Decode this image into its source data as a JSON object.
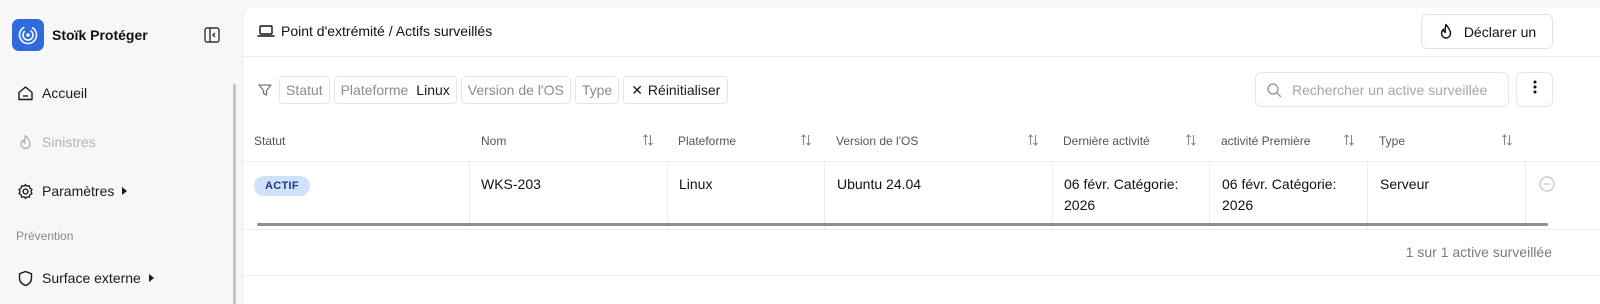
{
  "brand": {
    "name": "Stoïk Protéger",
    "accent": "#2f6bdc"
  },
  "sidebar": {
    "items": [
      {
        "label": "Accueil",
        "icon": "home-icon"
      },
      {
        "label": "Sinistres",
        "icon": "flame-icon",
        "disabled": true
      },
      {
        "label": "Paramètres",
        "icon": "gear-icon"
      }
    ],
    "section_label": "Prévention",
    "section_items": [
      {
        "label": "Surface externe",
        "icon": "shield-icon"
      }
    ]
  },
  "header": {
    "breadcrumb": "Point d'extrémité / Actifs surveillés",
    "declare_label": "Déclarer un"
  },
  "filters": {
    "statut": "Statut",
    "plateforme": "Plateforme",
    "plateforme_value": "Linux",
    "version": "Version de l'OS",
    "type": "Type",
    "reset": "Réinitialiser"
  },
  "search": {
    "placeholder": "Rechercher un active surveillée"
  },
  "table": {
    "columns": [
      "Statut",
      "Nom",
      "Plateforme",
      "Version de l'OS",
      "Dernière activité",
      "activité Première",
      "Type"
    ],
    "rows": [
      {
        "status": "ACTIF",
        "name": "WKS-203",
        "platform": "Linux",
        "os_version": "Ubuntu 24.04",
        "last_activity": "06 févr. Catégorie: 2026",
        "first_activity": "06 févr. Catégorie: 2026",
        "type": "Serveur"
      }
    ],
    "count_text": "1 sur 1 active surveillée"
  }
}
